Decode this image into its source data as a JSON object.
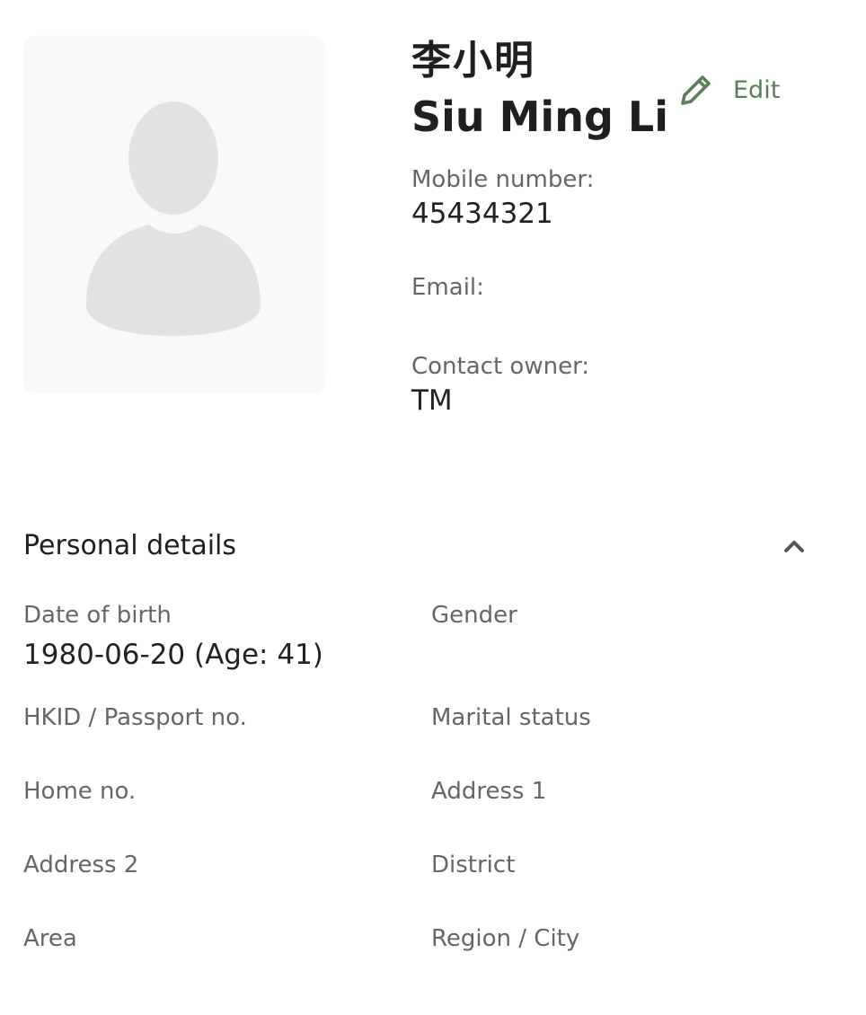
{
  "profile": {
    "name_chinese": "李小明",
    "name_english": "Siu Ming Li",
    "edit_label": "Edit",
    "avatar_icon": "person-silhouette-icon",
    "edit_icon": "pencil-icon"
  },
  "contact": {
    "mobile_label": "Mobile number:",
    "mobile_value": "45434321",
    "email_label": "Email:",
    "email_value": "",
    "owner_label": "Contact owner:",
    "owner_value": "TM"
  },
  "personal_details": {
    "title": "Personal details",
    "toggle_icon": "chevron-up-icon",
    "fields": {
      "dob_label": "Date of birth",
      "dob_value": "1980-06-20 (Age: 41)",
      "gender_label": "Gender",
      "gender_value": "",
      "hkid_label": "HKID / Passport no.",
      "hkid_value": "",
      "marital_label": "Marital status",
      "marital_value": "",
      "home_label": "Home no.",
      "home_value": "",
      "address1_label": "Address 1",
      "address1_value": "",
      "address2_label": "Address 2",
      "address2_value": "",
      "district_label": "District",
      "district_value": "",
      "area_label": "Area",
      "area_value": "",
      "region_label": "Region / City",
      "region_value": ""
    }
  },
  "colors": {
    "accent": "#5c7c5a",
    "label": "#666666",
    "text": "#222222",
    "avatar_bg": "#f9f9f9",
    "avatar_shape": "#e2e2e2"
  }
}
